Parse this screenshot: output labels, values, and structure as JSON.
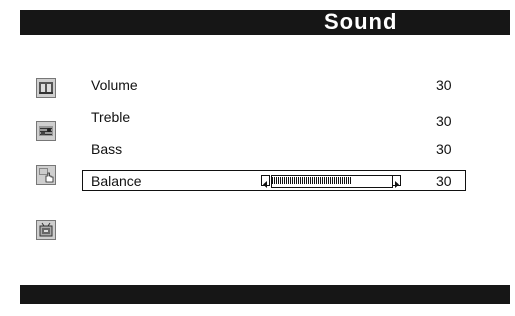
{
  "header": {
    "title": "Sound"
  },
  "sidebar": {
    "icons": [
      {
        "name": "picture-icon"
      },
      {
        "name": "sound-icon"
      },
      {
        "name": "setup-hand-icon"
      },
      {
        "name": "tv-channel-icon"
      }
    ]
  },
  "menu": {
    "items": [
      {
        "label": "Volume",
        "value": "30"
      },
      {
        "label": "Treble",
        "value": "30"
      },
      {
        "label": "Bass",
        "value": "30"
      },
      {
        "label": "Balance",
        "value": "30"
      }
    ],
    "selected_index": 3,
    "balance_slider": {
      "level_percent": 66
    }
  }
}
